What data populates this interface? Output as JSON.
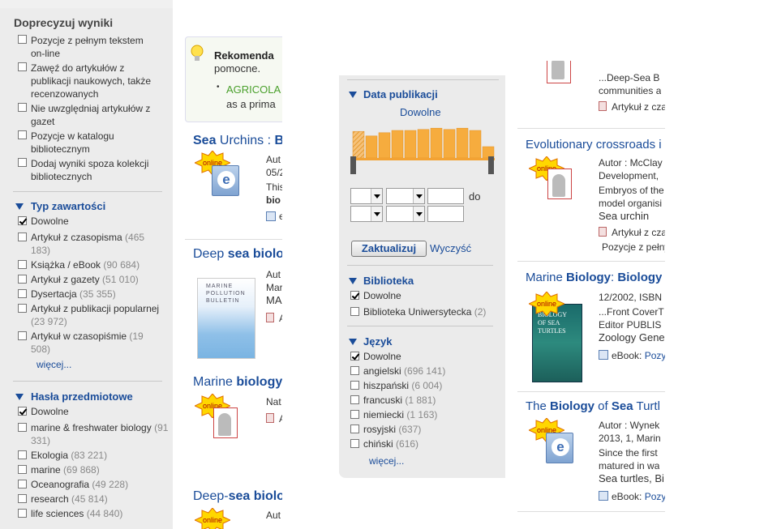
{
  "left_panel": {
    "title": "Doprecyzuj wyniki",
    "refine_options": [
      "Pozycje z pełnym tekstem on-line",
      "Zawęź do artykułów z publikacji naukowych, także recenzowanych",
      "Nie uwzględniaj artykułów z gazet",
      "Pozycje w katalogu bibliotecznym",
      "Dodaj wyniki spoza kolekcji bibliotecznych"
    ],
    "content_type": {
      "heading": "Typ zawartości",
      "items": [
        {
          "label": "Dowolne",
          "count": "",
          "checked": true
        },
        {
          "label": "Artykuł z czasopisma",
          "count": "(465 183)"
        },
        {
          "label": "Książka / eBook",
          "count": "(90 684)"
        },
        {
          "label": "Artykuł z gazety",
          "count": "(51 010)"
        },
        {
          "label": "Dysertacja",
          "count": "(35 355)"
        },
        {
          "label": "Artykuł z publikacji popularnej",
          "count": "(23 972)"
        },
        {
          "label": "Artykuł w czasopiśmie",
          "count": "(19 508)"
        }
      ],
      "more": "więcej..."
    },
    "subjects": {
      "heading": "Hasła przedmiotowe",
      "items": [
        {
          "label": "Dowolne",
          "count": "",
          "checked": true
        },
        {
          "label": "marine & freshwater biology",
          "count": "(91 331)"
        },
        {
          "label": "Ekologia",
          "count": "(83 221)"
        },
        {
          "label": "marine",
          "count": "(69 868)"
        },
        {
          "label": "Oceanografia",
          "count": "(49 228)"
        },
        {
          "label": "research",
          "count": "(45 814)"
        },
        {
          "label": "life sciences",
          "count": "(44 840)"
        }
      ]
    }
  },
  "results_left": {
    "recommendation": {
      "title": "Rekomenda",
      "line2": "pomocne.",
      "link": "AGRICOLA",
      "line3": "as a prima"
    },
    "items": [
      {
        "title_pre": "Sea",
        "title_mid": " Urchins : ",
        "title_b": "B",
        "meta": [
          "Aut",
          "05/2",
          "This",
          "bio"
        ],
        "footer": "e"
      },
      {
        "title_pre": "Deep ",
        "title_mid": "sea",
        "title_b": " biolo",
        "meta": [
          "Aut",
          "Mar",
          "MA",
          "A"
        ]
      },
      {
        "title_pre": "Marine ",
        "title_mid": "biology",
        "title_b": "",
        "meta": [
          "Nat",
          "A"
        ]
      },
      {
        "title_pre": "Deep-",
        "title_mid": "sea",
        "title_b": " biolo",
        "meta": [
          "Aut"
        ]
      }
    ],
    "online_label": "online"
  },
  "middle_panel": {
    "date": {
      "heading": "Data publikacji",
      "value": "Dowolne",
      "histogram": [
        0.82,
        0.68,
        0.78,
        0.85,
        0.85,
        0.88,
        0.92,
        0.88,
        0.92,
        0.85,
        0.35
      ],
      "to_label": "do",
      "update": "Zaktualizuj",
      "clear": "Wyczyść"
    },
    "library": {
      "heading": "Biblioteka",
      "items": [
        {
          "label": "Dowolne",
          "count": "",
          "checked": true
        },
        {
          "label": "Biblioteka Uniwersytecka",
          "count": "(2)"
        }
      ]
    },
    "language": {
      "heading": "Język",
      "items": [
        {
          "label": "Dowolne",
          "count": "",
          "checked": true
        },
        {
          "label": "angielski",
          "count": "(696 141)"
        },
        {
          "label": "hiszpański",
          "count": "(6 004)"
        },
        {
          "label": "francuski",
          "count": "(1 881)"
        },
        {
          "label": "niemiecki",
          "count": "(1 163)"
        },
        {
          "label": "rosyjski",
          "count": "(637)"
        },
        {
          "label": "chiński",
          "count": "(616)"
        }
      ],
      "more": "więcej..."
    }
  },
  "results_right": {
    "top": {
      "meta1": "...Deep-Sea B",
      "meta2": "communities a",
      "type": "Artykuł z czaso"
    },
    "items": [
      {
        "title": "Evolutionary crossroads i",
        "meta": [
          "Autor : McClay",
          "Development, ",
          "Embryos of the",
          "model organisi"
        ],
        "link": "Sea urchin",
        "type": "Artykuł z czaso",
        "fulltext": "Pozycje z pełny"
      },
      {
        "title_a": "Marine ",
        "title_b": "Biology",
        "title_c": ": ",
        "title_d": "Biology",
        "meta": [
          "12/2002, ISBN",
          "...Front CoverT",
          "Editor PUBLIS"
        ],
        "link": "Zoology Gener",
        "type": "eBook: ",
        "type_link": "Pozy"
      },
      {
        "title_a": "The ",
        "title_b": "Biology",
        "title_c": " of ",
        "title_d": "Sea",
        "title_e": " Turtl",
        "meta": [
          "Autor : Wynek",
          "2013, 1, Marin",
          "Since the first",
          "matured in wa"
        ],
        "link": "Sea turtles, Bi",
        "type": "eBook: ",
        "type_link": "Pozy"
      }
    ],
    "covers": {
      "marine": [
        "MARINE",
        "POLLUTION",
        "BULLETIN"
      ],
      "turtles": [
        "BIOLOGY",
        "OF SEA",
        "TURTLES"
      ]
    }
  }
}
